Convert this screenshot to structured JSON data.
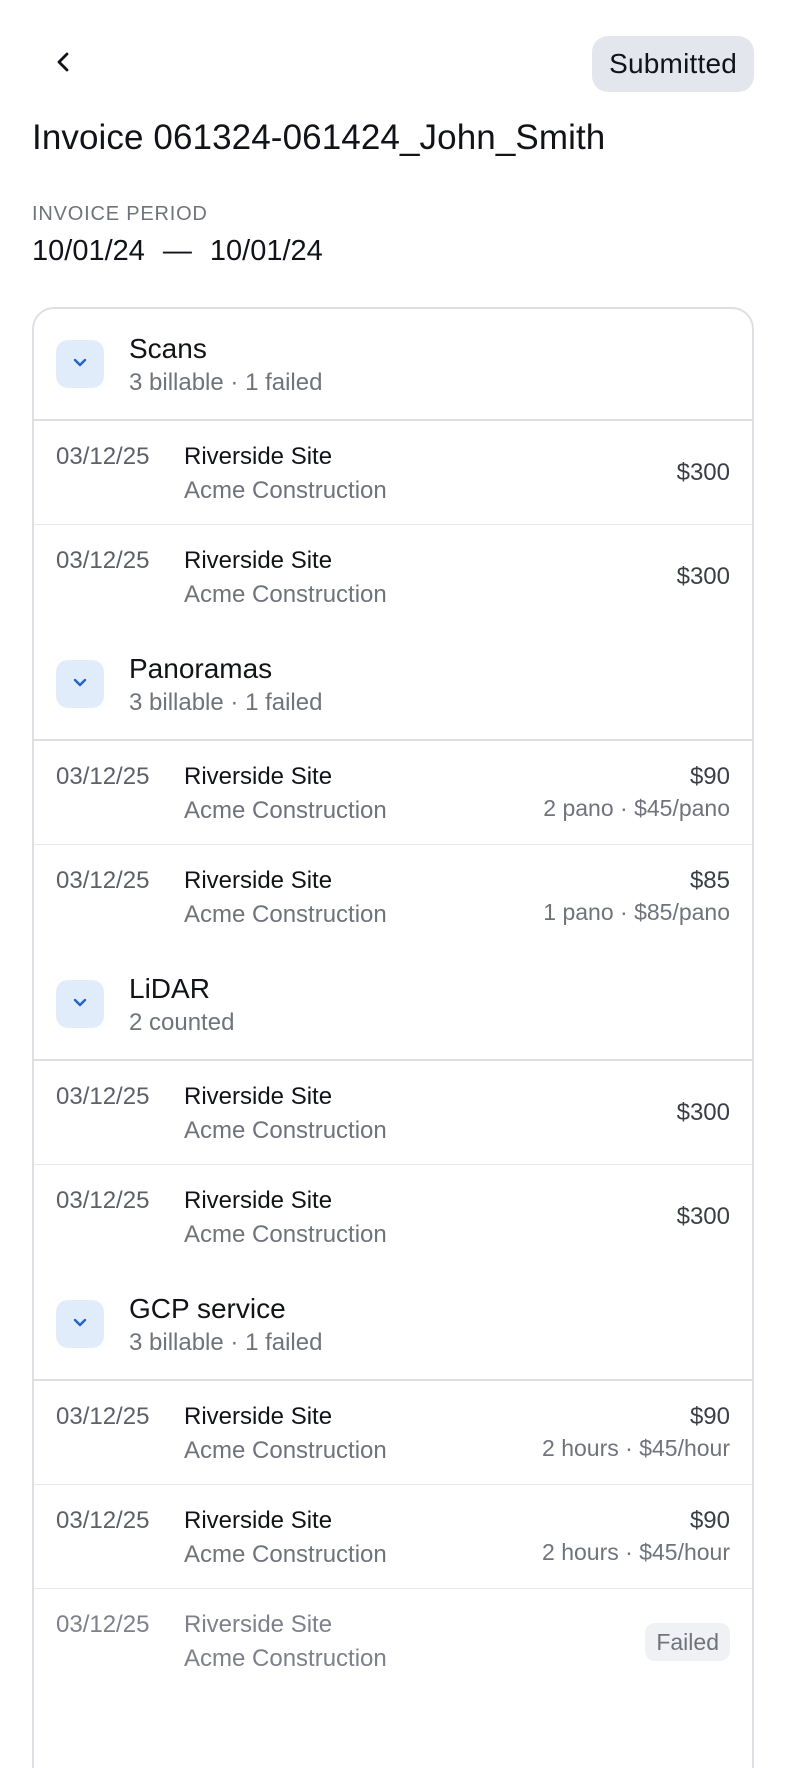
{
  "header": {
    "status": "Submitted",
    "title": "Invoice 061324-061424_John_Smith",
    "period_label": "INVOICE PERIOD",
    "period_start": "10/01/24",
    "period_separator": "—",
    "period_end": "10/01/24"
  },
  "icons": {
    "back": "chevron-left-icon",
    "toggle": "chevron-down-icon"
  },
  "colors": {
    "status_pill_bg": "#e4e6ee",
    "toggle_bg": "#e1ecfb",
    "toggle_icon": "#2563c9",
    "failed_badge_bg": "#f0f1f4"
  },
  "sections": [
    {
      "title": "Scans",
      "subtitle": "3 billable · 1 failed",
      "rows": [
        {
          "date": "03/12/25",
          "site": "Riverside Site",
          "company": "Acme Construction",
          "amount": "$300"
        },
        {
          "date": "03/12/25",
          "site": "Riverside Site",
          "company": "Acme Construction",
          "amount": "$300"
        }
      ]
    },
    {
      "title": "Panoramas",
      "subtitle": "3 billable · 1 failed",
      "rows": [
        {
          "date": "03/12/25",
          "site": "Riverside Site",
          "company": "Acme Construction",
          "amount": "$90",
          "detail": "2 pano · $45/pano"
        },
        {
          "date": "03/12/25",
          "site": "Riverside Site",
          "company": "Acme Construction",
          "amount": "$85",
          "detail": "1 pano · $85/pano"
        }
      ]
    },
    {
      "title": "LiDAR",
      "subtitle": "2 counted",
      "rows": [
        {
          "date": "03/12/25",
          "site": "Riverside Site",
          "company": "Acme Construction",
          "amount": "$300"
        },
        {
          "date": "03/12/25",
          "site": "Riverside Site",
          "company": "Acme Construction",
          "amount": "$300"
        }
      ]
    },
    {
      "title": "GCP service",
      "subtitle": "3 billable · 1 failed",
      "rows": [
        {
          "date": "03/12/25",
          "site": "Riverside Site",
          "company": "Acme Construction",
          "amount": "$90",
          "detail": "2 hours · $45/hour"
        },
        {
          "date": "03/12/25",
          "site": "Riverside Site",
          "company": "Acme Construction",
          "amount": "$90",
          "detail": "2 hours · $45/hour"
        },
        {
          "date": "03/12/25",
          "site": "Riverside Site",
          "company": "Acme Construction",
          "status": "Failed"
        }
      ]
    }
  ]
}
